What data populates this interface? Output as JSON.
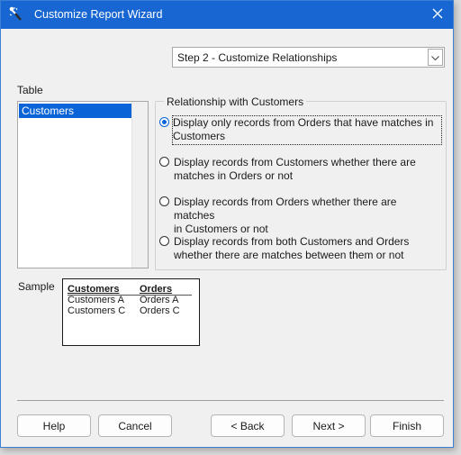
{
  "window": {
    "title": "Customize Report Wizard"
  },
  "step_select": {
    "value": "Step 2 - Customize Relationships"
  },
  "table": {
    "label": "Table",
    "items": [
      "Customers"
    ],
    "selected": "Customers"
  },
  "relationship": {
    "group_label": "Relationship with Customers",
    "options": [
      {
        "line1": "Display only records from Orders that have matches in",
        "line2": "Customers",
        "checked": true
      },
      {
        "line1": "Display records from Customers whether there are",
        "line2": "matches in Orders or not",
        "checked": false
      },
      {
        "line1": "Display records from Orders whether there are matches",
        "line2": "in Customers or not",
        "checked": false
      },
      {
        "line1": "Display records from both Customers and Orders",
        "line2": "whether there are matches between them or not",
        "checked": false
      }
    ]
  },
  "sample": {
    "label": "Sample",
    "headers": [
      "Customers",
      "Orders"
    ],
    "rows": [
      [
        "Customers A",
        "Orders A"
      ],
      [
        "Customers C",
        "Orders C"
      ]
    ]
  },
  "buttons": {
    "help": "Help",
    "cancel": "Cancel",
    "back": "< Back",
    "next": "Next >",
    "finish": "Finish"
  },
  "icons": {
    "title": "wizard-wand-icon",
    "close": "close-icon",
    "dropdown": "chevron-down-icon"
  },
  "colors": {
    "titlebar": "#1766d1",
    "selection": "#0a64d8"
  }
}
